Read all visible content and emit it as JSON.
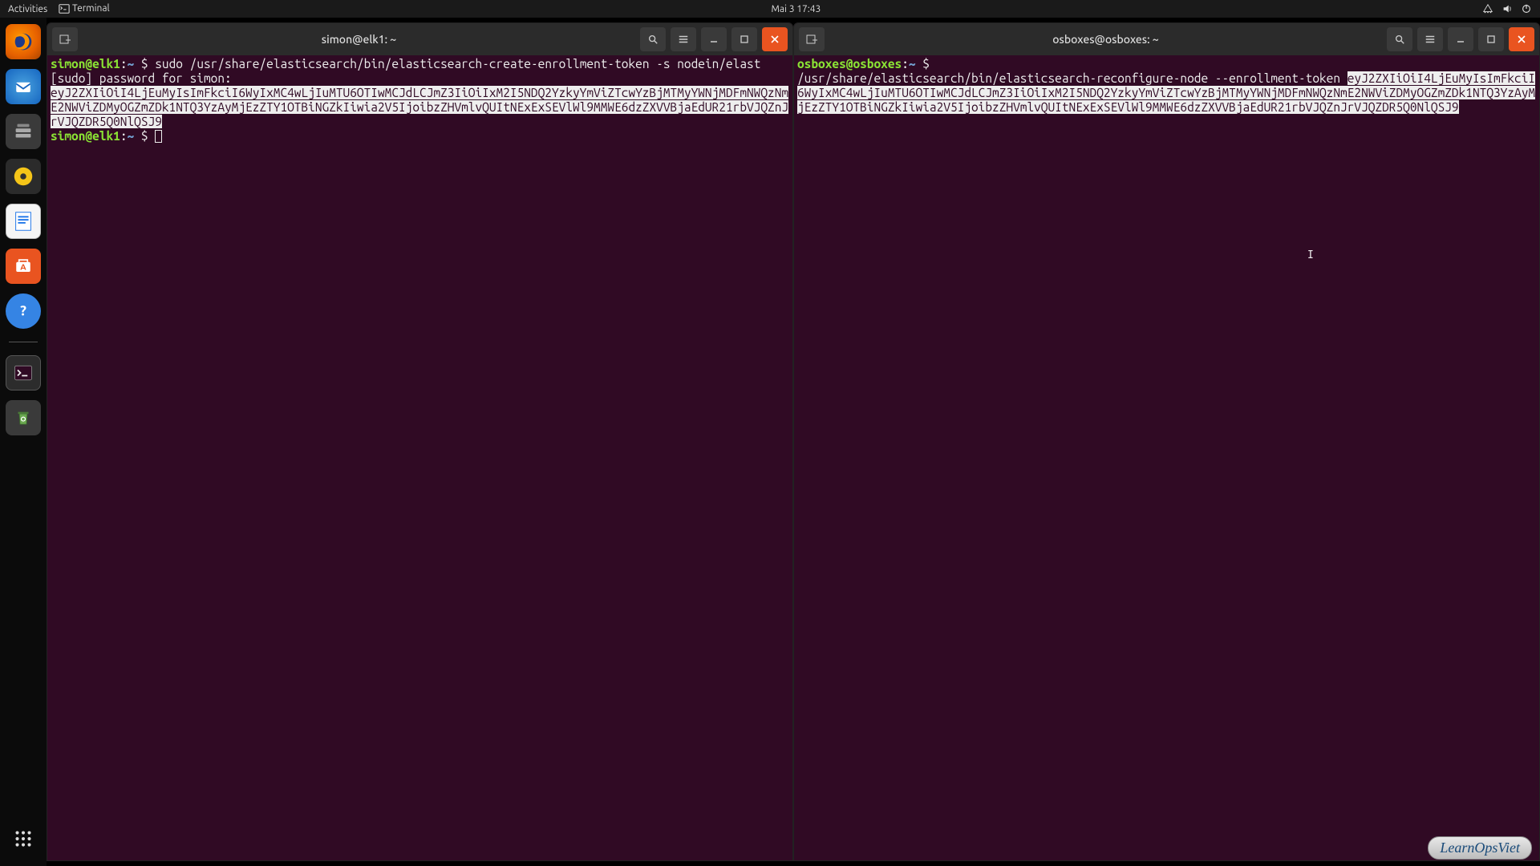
{
  "topbar": {
    "activities": "Activities",
    "app": "Terminal",
    "datetime": "Mai 3  17:43"
  },
  "dock": {
    "items": [
      {
        "name": "firefox"
      },
      {
        "name": "thunderbird"
      },
      {
        "name": "files"
      },
      {
        "name": "rhythmbox"
      },
      {
        "name": "libreoffice-writer"
      },
      {
        "name": "ubuntu-software"
      },
      {
        "name": "help"
      },
      {
        "name": "terminal"
      },
      {
        "name": "trash"
      }
    ],
    "apps_label": "Show Applications"
  },
  "terminals": {
    "left": {
      "title": "simon@elk1: ~",
      "prompt_user": "simon@elk1",
      "prompt_path": "~",
      "line1_cmd": "sudo /usr/share/elasticsearch/bin/elasticsearch-create-enrollment-token -s nodein/elast",
      "line2": "[sudo] password for simon:",
      "token": "eyJ2ZXIiOiI4LjEuMyIsImFkciI6WyIxMC4wLjIuMTU6OTIwMCJdLCJmZ3IiOiIxM2I5NDQ2YzkyYmViZTcwYzBjMTMyYWNjMDFmNWQzNmE2NWViZDMyOGZmZDk1NTQ3YzAyMjEzZTY1OTBiNGZkIiwia2V5IjoibzZHVmlvQUItNExExSEVlWl9MMWE6dzZXVVBjaEdUR21rbVJQZnJrVJQZDR5Q0NlQSJ9",
      "token_tail": "1rbVJQZDR5Q0NlQSJ9"
    },
    "right": {
      "title": "osboxes@osboxes: ~",
      "prompt_user": "osboxes@osboxes",
      "prompt_path": "~",
      "cmd_prefix": "/usr/share/elasticsearch/bin/elasticsearch-reconfigure-node --enrollment-token ",
      "token": "eyJ2ZXIiOiI4LjEuMyIsImFkciI6WyIxMC4wLjIuMTU6OTIwMCJdLCJmZ3IiOiIxM2I5NDQ2YzkyYmViZTcwYzBjMTMyYWNjMDFmNWQzNmE2NWViZDMyOGZmZDk1NTQ3YzAyMjEzZTY1OTBiNGZkIiwia2V5IjoibzZHVmlvQUItNExExSEVlWl9MMWE6dzZXVVBjaEdUR21rbVJQZnJrVJQZDR5Q0NlQSJ9"
    }
  },
  "right_cursor": "I",
  "watermark": "LearnOpsViet"
}
